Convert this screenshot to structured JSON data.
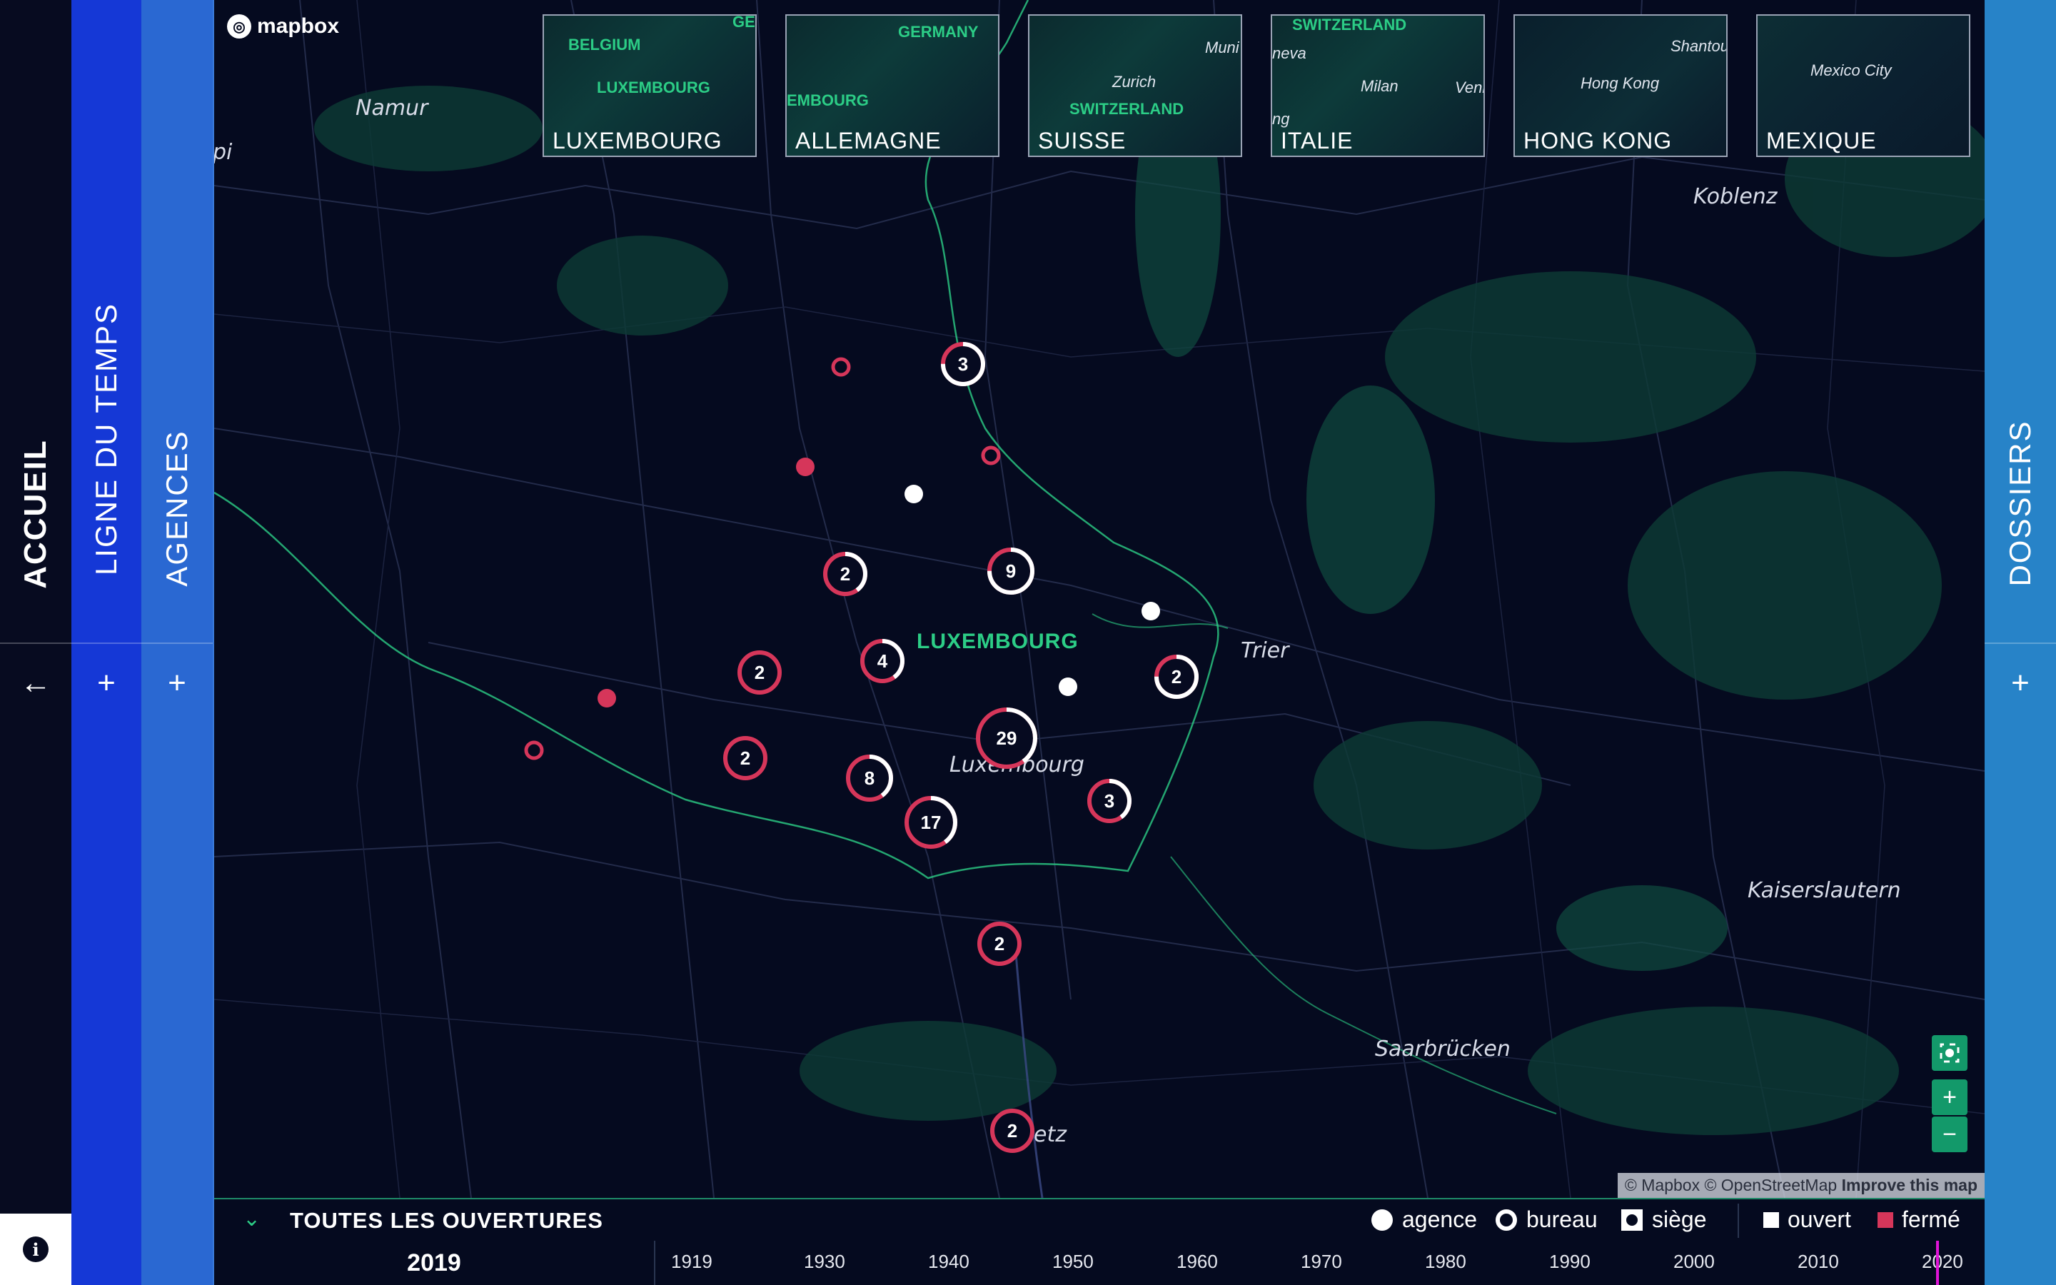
{
  "nav": {
    "accueil": "ACCUEIL",
    "ligne_du_temps": "LIGNE DU TEMPS",
    "agences": "AGENCES",
    "dossiers": "DOSSIERS",
    "back_icon": "←",
    "plus": "+",
    "info": "i"
  },
  "map": {
    "logo": "mapbox",
    "places": [
      "Namur",
      "Koblenz",
      "Trier",
      "Luxembourg",
      "Kaiserslautern",
      "Saarbrücken",
      "etz",
      "pi"
    ],
    "country_label": "LUXEMBOURG",
    "attribution": {
      "text": "© Mapbox © OpenStreetMap",
      "link": "Improve this map"
    },
    "clusters": [
      {
        "count": "3",
        "type": "bureau"
      },
      {
        "count": "9",
        "type": "bureau"
      },
      {
        "count": "2",
        "type": "mixed"
      },
      {
        "count": "4",
        "type": "mixed"
      },
      {
        "count": "2",
        "type": "bureau"
      },
      {
        "count": "2",
        "type": "ferme"
      },
      {
        "count": "29",
        "type": "mixed"
      },
      {
        "count": "2",
        "type": "ferme"
      },
      {
        "count": "8",
        "type": "mixed"
      },
      {
        "count": "17",
        "type": "mixed"
      },
      {
        "count": "3",
        "type": "mixed"
      },
      {
        "count": "2",
        "type": "ferme"
      },
      {
        "count": "2",
        "type": "ferme"
      }
    ],
    "controls": {
      "locate_icon": "target-icon",
      "zoom_in": "+",
      "zoom_out": "−"
    }
  },
  "minimaps": [
    {
      "title": "LUXEMBOURG",
      "labels": [
        "BELGIUM",
        "LUXEMBOURG",
        "GE"
      ]
    },
    {
      "title": "ALLEMAGNE",
      "labels": [
        "GERMANY",
        "EMBOURG"
      ]
    },
    {
      "title": "SUISSE",
      "labels": [
        "Zurich",
        "SWITZERLAND",
        "Muni"
      ]
    },
    {
      "title": "ITALIE",
      "labels": [
        "SWITZERLAND",
        "Milan",
        "neva",
        "Veni",
        "ng"
      ]
    },
    {
      "title": "HONG KONG",
      "labels": [
        "Hong Kong",
        "Shantou"
      ]
    },
    {
      "title": "MEXIQUE",
      "labels": [
        "Mexico City"
      ]
    }
  ],
  "legend": {
    "title": "TOUTES LES OUVERTURES",
    "chevron": "⌄",
    "items": [
      "agence",
      "bureau",
      "siège",
      "ouvert",
      "fermé"
    ]
  },
  "timeline": {
    "current_year": "2019",
    "ticks": [
      "1919",
      "1930",
      "1940",
      "1950",
      "1960",
      "1970",
      "1980",
      "1990",
      "2000",
      "2010",
      "2020"
    ]
  },
  "colors": {
    "accent_green": "#2ccd86",
    "closed_red": "#d6365a",
    "nav_blue": "#1538d6",
    "agences_blue": "#2a68d2",
    "dossiers_blue": "#2783c8"
  }
}
